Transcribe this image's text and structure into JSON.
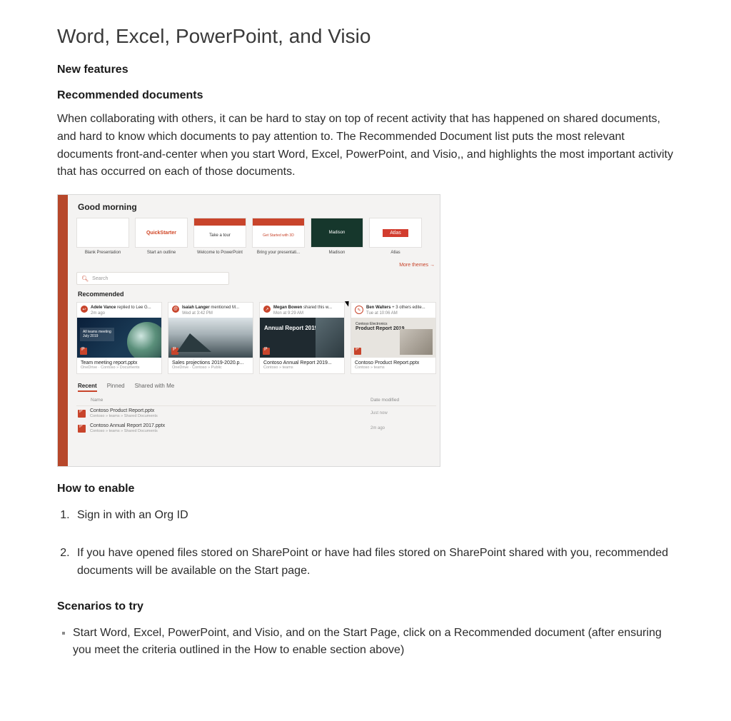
{
  "title": "Word, Excel, PowerPoint, and Visio",
  "h_newfeatures": "New features",
  "h_recommended": "Recommended documents",
  "paragraph": "When collaborating with others, it can be hard to stay on top of recent activity that has happened on shared documents, and hard to know which documents to pay attention to. The Recommended Document list puts the most relevant documents front-and-center when you start Word, Excel, PowerPoint, and Visio,, and highlights the most important activity that has occurred on each of those documents.",
  "h_enable": "How to enable",
  "steps": [
    "Sign in with an Org ID",
    "If you have opened files stored on SharePoint or have had files stored on SharePoint shared with you, recommended documents will be available on the Start page."
  ],
  "h_scenarios": "Scenarios to try",
  "scenario1": "Start Word, Excel, PowerPoint, and Visio, and on the Start Page, click on a Recommended document (after ensuring you meet the criteria outlined in the How to enable section above)",
  "shot": {
    "greeting": "Good morning",
    "templates": [
      {
        "caption": "Blank Presentation",
        "thumb": ""
      },
      {
        "caption": "Start an outline",
        "thumb": "QuickStarter"
      },
      {
        "caption": "Welcome to PowerPoint",
        "thumb": "Take a tour"
      },
      {
        "caption": "Bring your presentati...",
        "thumb": "Get Started with 3D"
      },
      {
        "caption": "Madison",
        "thumb": "Madison"
      },
      {
        "caption": "Atlas",
        "thumb": "Atlas"
      }
    ],
    "more_themes": "More themes →",
    "search_placeholder": "Search",
    "rec_heading": "Recommended",
    "cards": [
      {
        "actor": "Adele Vance",
        "action": "replied to Lee G...",
        "when": "2m ago",
        "img_label_a": "All teams meeting",
        "img_label_b": "July 2019",
        "file": "Team meeting report.pptx",
        "loc": "OneDrive · Contoso » Documents"
      },
      {
        "actor": "Isaiah Langer",
        "action": "mentioned M...",
        "when": "Wed at 3:42 PM",
        "file": "Sales projections 2019-2020.p...",
        "loc": "OneDrive · Contoso » Public"
      },
      {
        "actor": "Megan Bowen",
        "action": "shared this w...",
        "when": "Mon at 9:29 AM",
        "img_label": "Annual Report 2019",
        "file": "Contoso Annual Report 2019...",
        "loc": "Contoso » teams"
      },
      {
        "actor": "Ben Walters",
        "action": "+ 3 others edite...",
        "when": "Tue at 10:06 AM",
        "img_label": "Product Report 2019",
        "file": "Contoso Product Report.pptx",
        "loc": "Contoso » teams"
      }
    ],
    "tabs": [
      "Recent",
      "Pinned",
      "Shared with Me"
    ],
    "col_name": "Name",
    "col_date": "Date modified",
    "files": [
      {
        "name": "Contoso Product Report.pptx",
        "loc": "Contoso » teams » Shared Documents",
        "when": "Just now"
      },
      {
        "name": "Contoso Annual Report 2017.pptx",
        "loc": "Contoso » teams » Shared Documents",
        "when": "2m ago"
      }
    ]
  }
}
